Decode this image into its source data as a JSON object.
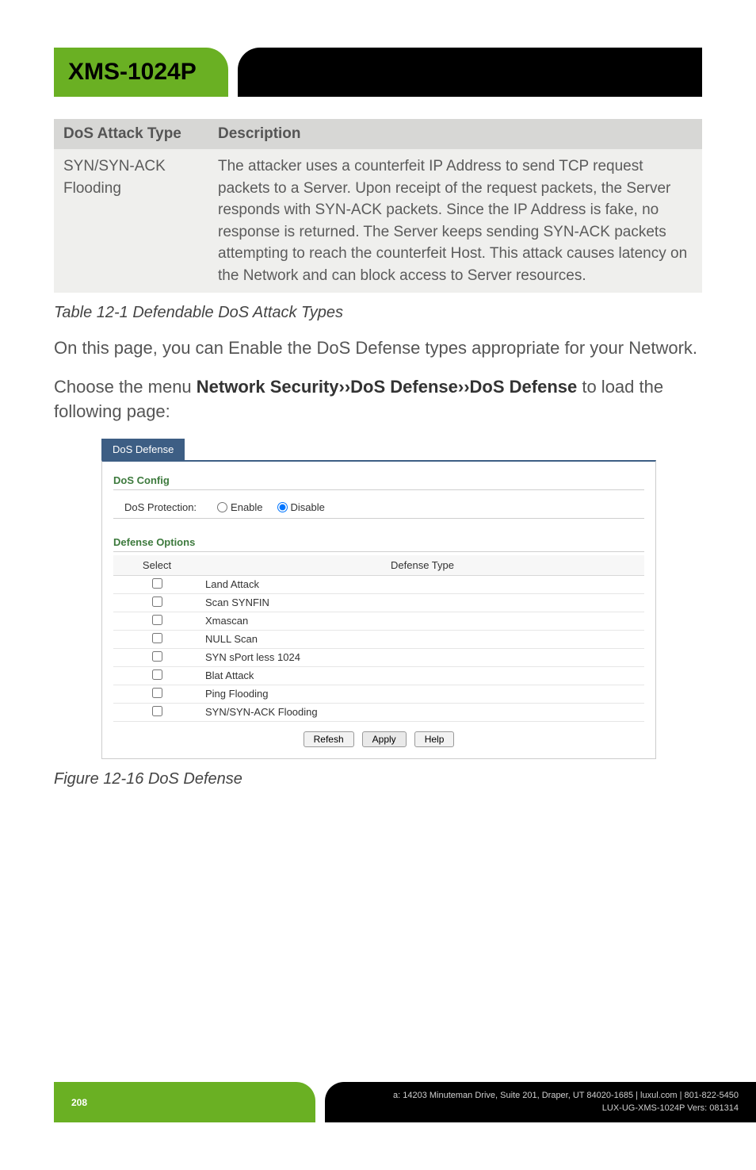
{
  "product_name": "XMS-1024P",
  "dos_table": {
    "headers": {
      "type": "DoS Attack Type",
      "desc": "Description"
    },
    "row": {
      "type": "SYN/SYN-ACK Flooding",
      "desc": "The attacker uses a counterfeit IP Address to send TCP request packets to a Server. Upon receipt of the request packets, the Server responds with SYN-ACK packets. Since the IP Address is fake, no response is returned. The Server keeps sending SYN-ACK packets attempting to reach the counterfeit Host. This attack causes latency on the Network and can block access to Server resources."
    }
  },
  "table_caption": "Table 12-1 Defendable DoS Attack Types",
  "para1": "On this page, you can Enable the DoS Defense types appropriate for your Network.",
  "para2_pre": "Choose the menu ",
  "para2_strong": "Network Security››DoS Defense››DoS Defense",
  "para2_post": " to load the following page:",
  "screenshot": {
    "tab": "DoS Defense",
    "config_title": "DoS Config",
    "protection_label": "DoS Protection:",
    "radio_enable": "Enable",
    "radio_disable": "Disable",
    "options_title": "Defense Options",
    "headers": {
      "select": "Select",
      "type": "Defense Type"
    },
    "items": [
      "Land Attack",
      "Scan SYNFIN",
      "Xmascan",
      "NULL Scan",
      "SYN sPort less 1024",
      "Blat Attack",
      "Ping Flooding",
      "SYN/SYN-ACK Flooding"
    ],
    "buttons": {
      "refresh": "Refesh",
      "apply": "Apply",
      "help": "Help"
    }
  },
  "figure_caption": "Figure 12-16 DoS Defense",
  "footer": {
    "page": "208",
    "addr": "a: 14203 Minuteman Drive, Suite 201, Draper, UT 84020-1685 | luxul.com | 801-822-5450",
    "doc": "LUX-UG-XMS-1024P  Vers: 081314"
  }
}
